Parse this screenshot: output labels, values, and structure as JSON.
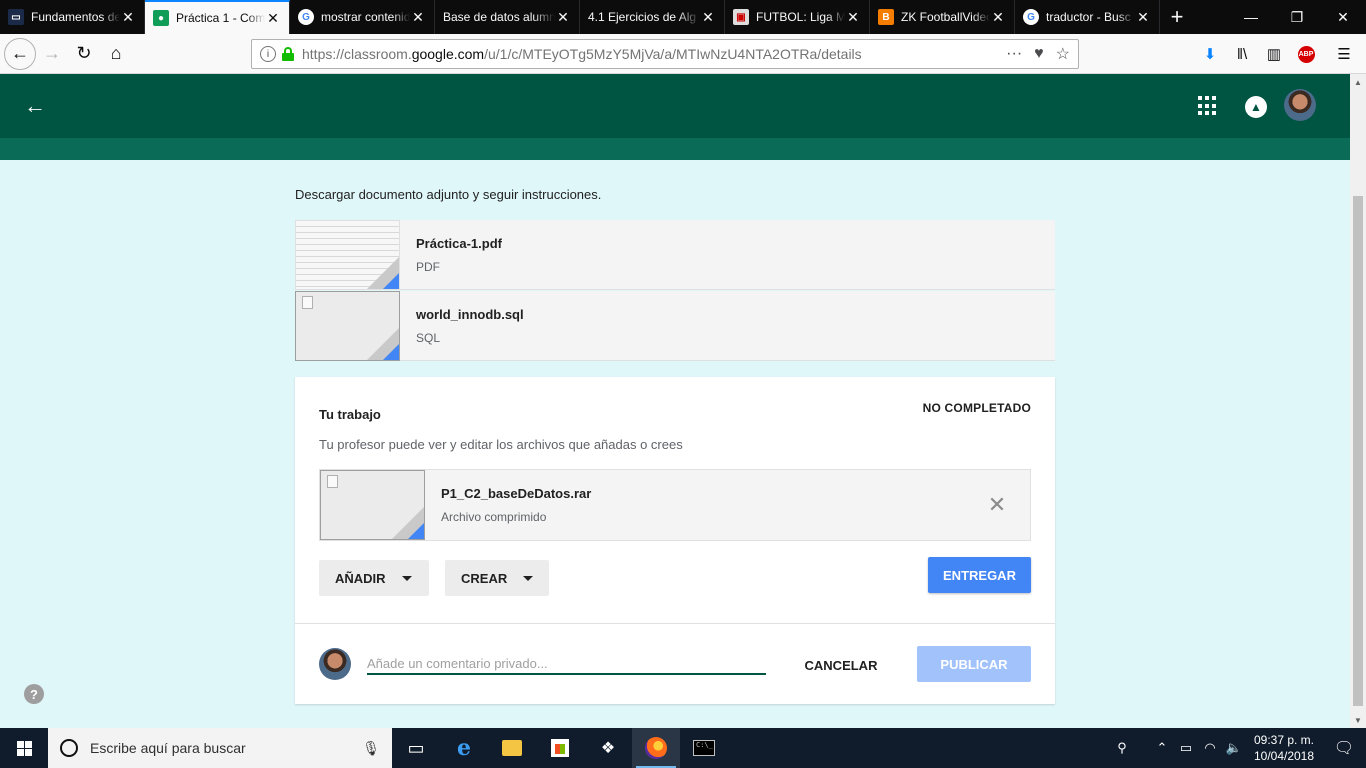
{
  "browser": {
    "tabs": [
      {
        "title": "Fundamentos de",
        "favicon": "classroom-dark-icon",
        "active": false
      },
      {
        "title": "Práctica 1 - Com",
        "favicon": "classroom-icon",
        "active": true
      },
      {
        "title": "mostrar contenido",
        "favicon": "google-icon",
        "active": false
      },
      {
        "title": "Base de datos alumno",
        "favicon": "none",
        "active": false
      },
      {
        "title": "4.1 Ejercicios de Alg",
        "favicon": "none",
        "active": false
      },
      {
        "title": "FUTBOL: Liga M",
        "favicon": "image-icon",
        "active": false
      },
      {
        "title": "ZK FootballVideo",
        "favicon": "blogger-icon",
        "active": false
      },
      {
        "title": "traductor - Busc",
        "favicon": "google-icon",
        "active": false
      }
    ],
    "url_prefix": "https://classroom.",
    "url_domain": "google.com",
    "url_suffix": "/u/1/c/MTEyOTg5MzY5MjVa/a/MTIwNzU4NTA2OTRa/details",
    "adblock_label": "ABP"
  },
  "assignment": {
    "instructions": "Descargar documento adjunto y seguir instrucciones.",
    "attachments": [
      {
        "name": "Práctica-1.pdf",
        "type": "PDF"
      },
      {
        "name": "world_innodb.sql",
        "type": "SQL"
      }
    ]
  },
  "work": {
    "title": "Tu trabajo",
    "status": "NO COMPLETADO",
    "description": "Tu profesor puede ver y editar los archivos que añadas o crees",
    "file": {
      "name": "P1_C2_baseDeDatos.rar",
      "type": "Archivo comprimido"
    },
    "add_label": "AÑADIR",
    "create_label": "CREAR",
    "submit_label": "ENTREGAR",
    "comment_placeholder": "Añade un comentario privado...",
    "cancel_label": "CANCELAR",
    "publish_label": "PUBLICAR"
  },
  "colors": {
    "classroom_green": "#005442",
    "accent_blue": "#4285f4",
    "background": "#e0f7fa"
  },
  "taskbar": {
    "search_placeholder": "Escribe aquí para buscar",
    "time": "09:37 p. m.",
    "date": "10/04/2018"
  }
}
